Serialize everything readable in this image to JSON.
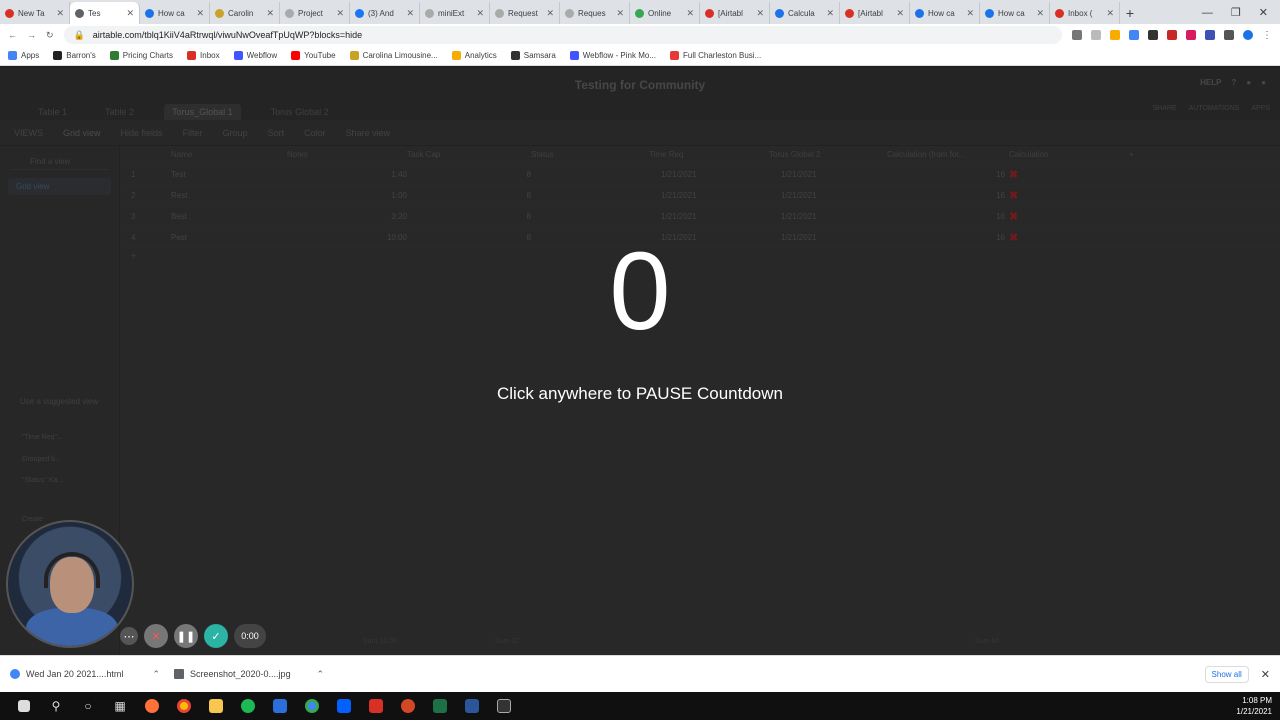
{
  "browser": {
    "tabs": [
      {
        "label": "New Ta",
        "color": "#d93025"
      },
      {
        "label": "Tes",
        "color": "#5f6368",
        "active": true
      },
      {
        "label": "How ca",
        "color": "#1a73e8"
      },
      {
        "label": "Carolin",
        "color": "#c9a227"
      },
      {
        "label": "Project",
        "color": "#aaaaaa"
      },
      {
        "label": "(3) And",
        "color": "#1877f2"
      },
      {
        "label": "miniExt",
        "color": "#aaaaaa"
      },
      {
        "label": "Request",
        "color": "#aaaaaa"
      },
      {
        "label": "Reques",
        "color": "#aaaaaa"
      },
      {
        "label": "Online",
        "color": "#34a853"
      },
      {
        "label": "[Airtabl",
        "color": "#d93025"
      },
      {
        "label": "Calcula",
        "color": "#1a73e8"
      },
      {
        "label": "[Airtabl",
        "color": "#d93025"
      },
      {
        "label": "How ca",
        "color": "#1a73e8"
      },
      {
        "label": "How ca",
        "color": "#1a73e8"
      },
      {
        "label": "Inbox (",
        "color": "#d93025"
      }
    ],
    "url": "airtable.com/tblq1KiiV4aRtrwql/viwuNwOveafTpUqWP?blocks=hide",
    "bookmarks": [
      {
        "label": "Apps",
        "color": "#4285f4"
      },
      {
        "label": "Barron's",
        "color": "#222222"
      },
      {
        "label": "Pricing Charts",
        "color": "#2e7d32"
      },
      {
        "label": "Inbox",
        "color": "#d93025"
      },
      {
        "label": "Webflow",
        "color": "#4353ff"
      },
      {
        "label": "YouTube",
        "color": "#ff0000"
      },
      {
        "label": "Carolina Limousine...",
        "color": "#c9a227"
      },
      {
        "label": "Analytics",
        "color": "#f9ab00"
      },
      {
        "label": "Samsara",
        "color": "#333333"
      },
      {
        "label": "Webflow - Pink Mo...",
        "color": "#4353ff"
      },
      {
        "label": "Full Charleston Busi...",
        "color": "#e53935"
      }
    ]
  },
  "airtable": {
    "base_title": "Testing for Community",
    "help": "HELP",
    "tables": [
      "Table 1",
      "Table 2",
      "Torus_Global 1",
      "Torus Global 2"
    ],
    "share": "SHARE",
    "automations": "AUTOMATIONS",
    "apps": "APPS",
    "toolbar": [
      "VIEWS",
      "Grid view",
      "Hide fields",
      "Filter",
      "Group",
      "Sort",
      "Color",
      "Share view"
    ],
    "sidebar": {
      "find": "Find a view",
      "grid_view": "Grid view",
      "suggested": "Use a suggested view",
      "items": [
        "\"Time Req\"...",
        "Grouped b...",
        "\"Status\" Ka..."
      ],
      "create": "Create"
    },
    "columns": [
      "Name",
      "Notes",
      "Task Cap",
      "Status",
      "Time Req",
      "Torus Global 2",
      "Calculation (from for...",
      "Calculation"
    ],
    "rows": [
      {
        "n": "1",
        "name": "Test",
        "time": "1:40",
        "cap": "8",
        "date": "1/21/2021",
        "tg": "1/21/2021",
        "calc": "16"
      },
      {
        "n": "2",
        "name": "Rest",
        "time": "1:00",
        "cap": "8",
        "date": "1/21/2021",
        "tg": "1/21/2021",
        "calc": "16"
      },
      {
        "n": "3",
        "name": "Best",
        "time": "3:20",
        "cap": "8",
        "date": "1/21/2021",
        "tg": "1/21/2021",
        "calc": "16"
      },
      {
        "n": "4",
        "name": "Pest",
        "time": "10:00",
        "cap": "8",
        "date": "1/21/2021",
        "tg": "1/21/2021",
        "calc": "16"
      }
    ],
    "sums": {
      "time": "Sum 16:00",
      "cap": "Sum 32",
      "calc": "Sum 64"
    }
  },
  "overlay": {
    "countdown": "0",
    "message": "Click anywhere to PAUSE Countdown"
  },
  "recorder": {
    "time": "0:00"
  },
  "downloads": [
    {
      "label": "Wed Jan 20 2021....html",
      "color": "#4285f4"
    },
    {
      "label": "Screenshot_2020-0....jpg",
      "color": "#5f6368"
    }
  ],
  "download_show_all": "Show all",
  "taskbar": {
    "time": "1:08 PM",
    "date": "1/21/2021"
  }
}
